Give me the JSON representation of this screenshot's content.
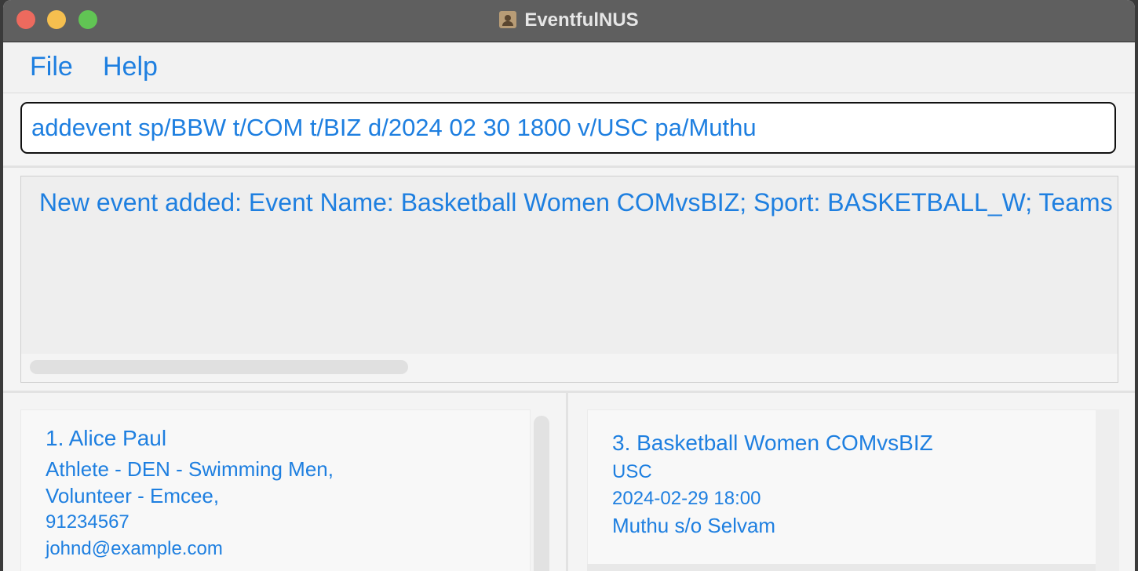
{
  "window": {
    "title": "EventfulNUS"
  },
  "menu": {
    "file": "File",
    "help": "Help"
  },
  "command": {
    "value": "addevent sp/BBW t/COM t/BIZ d/2024 02 30 1800 v/USC pa/Muthu"
  },
  "result": {
    "text": "New event added: Event Name: Basketball Women COMvsBIZ; Sport: BASKETBALL_W; Teams"
  },
  "persons": [
    {
      "name": "1. Alice Paul",
      "roles": [
        "Athlete - DEN - Swimming Men,",
        "Volunteer - Emcee,"
      ],
      "phone": "91234567",
      "email": "johnd@example.com"
    }
  ],
  "events": [
    {
      "name": "3. Basketball Women COMvsBIZ",
      "venue": "USC",
      "datetime": "2024-02-29 18:00",
      "participant": "Muthu s/o Selvam"
    }
  ]
}
